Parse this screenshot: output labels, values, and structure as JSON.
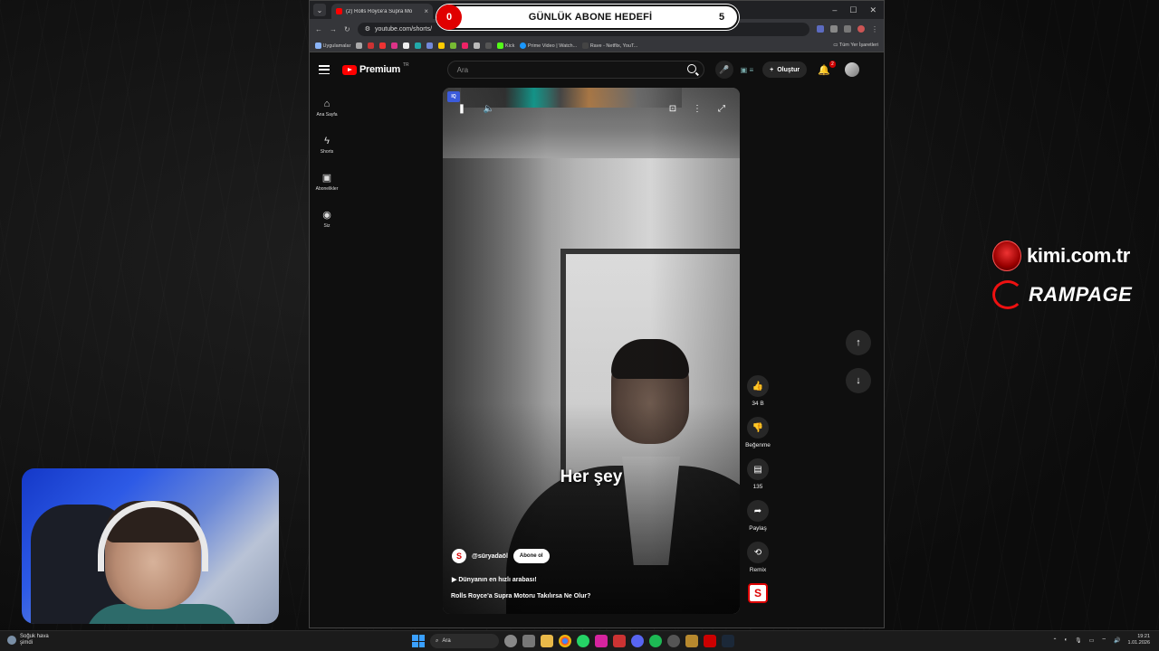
{
  "goal_overlay": {
    "current": "0",
    "title": "GÜNLÜK ABONE HEDEFİ",
    "target": "5"
  },
  "browser": {
    "tab_title": "(2) Rolls Royce'a Supra Mo",
    "address": "youtube.com/shorts/",
    "bookmarks": [
      "Uygulamalar",
      "Kick",
      "Prime Video | Watch...",
      "Rave - Netflix, YouT..."
    ],
    "bookmarks_right": "Tüm Yer İşaretleri"
  },
  "youtube": {
    "logo_text": "Premium",
    "country_code": "TR",
    "search_placeholder": "Ara",
    "create_label": "Oluştur",
    "notification_count": "2",
    "guide": [
      {
        "label": "Ana Sayfa",
        "icon": "home-icon"
      },
      {
        "label": "Shorts",
        "icon": "shorts-icon"
      },
      {
        "label": "Abonelikler",
        "icon": "subscriptions-icon"
      },
      {
        "label": "Siz",
        "icon": "you-icon"
      }
    ]
  },
  "short": {
    "caption": "Her şey",
    "channel": "@süryadaöl",
    "subscribe_label": "Abone ol",
    "music_line": "Dünyanın en hızlı arabası!",
    "title": "Rolls Royce'a Supra Motoru Takılırsa Ne Olur?",
    "iq_badge": "IQ",
    "actions": {
      "like_count": "34 B",
      "dislike_label": "Beğenme",
      "comment_count": "135",
      "share_label": "Paylaş",
      "remix_label": "Remix"
    }
  },
  "sponsors": {
    "site": "kimi.com.tr",
    "brand": "RAMPAGE"
  },
  "taskbar": {
    "weather_title": "Soğuk hava",
    "weather_sub": "şimdi",
    "search_label": "Ara",
    "time": "19:21",
    "date": "1.01.2026"
  }
}
